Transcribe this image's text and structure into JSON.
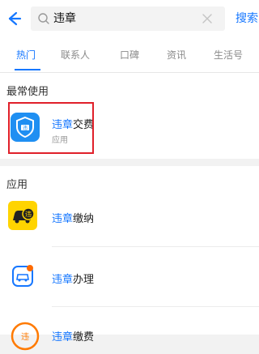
{
  "header": {
    "back_icon": "arrow-left-icon",
    "search_query": "违章",
    "search_button": "搜索"
  },
  "tabs": [
    {
      "label": "热门",
      "active": true
    },
    {
      "label": "联系人",
      "active": false
    },
    {
      "label": "口碑",
      "active": false
    },
    {
      "label": "资讯",
      "active": false
    },
    {
      "label": "生活号",
      "active": false
    }
  ],
  "frequent": {
    "title": "最常使用",
    "item": {
      "highlight": "违章",
      "rest": "交费",
      "subtitle": "应用",
      "icon": "shield-traffic-icon"
    }
  },
  "apps": {
    "title": "应用",
    "items": [
      {
        "highlight": "违章",
        "rest": "缴纳",
        "icon": "car-ticket-icon"
      },
      {
        "highlight": "违章",
        "rest": "办理",
        "icon": "car-badge-icon"
      },
      {
        "highlight": "违章",
        "rest": "缴费",
        "icon": "violation-circle-icon"
      }
    ]
  },
  "colors": {
    "accent": "#1677ff",
    "highlight_border": "#e0202a"
  }
}
